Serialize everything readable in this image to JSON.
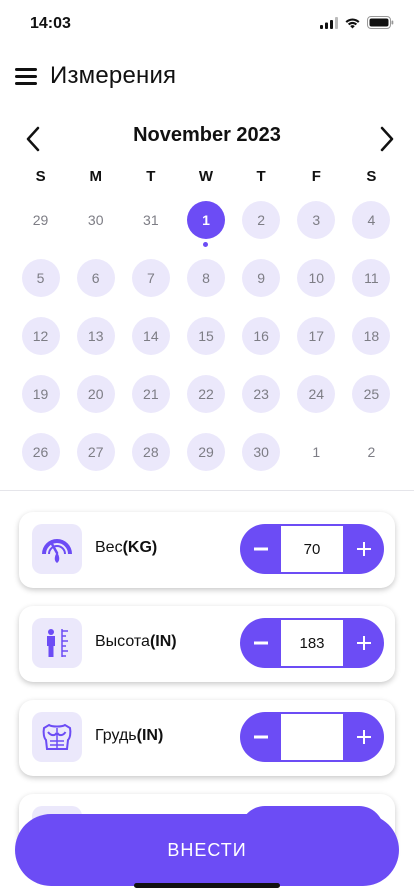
{
  "status_bar": {
    "time": "14:03"
  },
  "header": {
    "title": "Измерения"
  },
  "calendar": {
    "month_label": "November 2023",
    "weekdays": [
      "S",
      "M",
      "T",
      "W",
      "T",
      "F",
      "S"
    ],
    "days": [
      {
        "label": "29",
        "in_month": false
      },
      {
        "label": "30",
        "in_month": false
      },
      {
        "label": "31",
        "in_month": false
      },
      {
        "label": "1",
        "in_month": true,
        "selected": true,
        "has_entry": true
      },
      {
        "label": "2",
        "in_month": true
      },
      {
        "label": "3",
        "in_month": true
      },
      {
        "label": "4",
        "in_month": true
      },
      {
        "label": "5",
        "in_month": true
      },
      {
        "label": "6",
        "in_month": true
      },
      {
        "label": "7",
        "in_month": true
      },
      {
        "label": "8",
        "in_month": true
      },
      {
        "label": "9",
        "in_month": true
      },
      {
        "label": "10",
        "in_month": true
      },
      {
        "label": "11",
        "in_month": true
      },
      {
        "label": "12",
        "in_month": true
      },
      {
        "label": "13",
        "in_month": true
      },
      {
        "label": "14",
        "in_month": true
      },
      {
        "label": "15",
        "in_month": true
      },
      {
        "label": "16",
        "in_month": true
      },
      {
        "label": "17",
        "in_month": true
      },
      {
        "label": "18",
        "in_month": true
      },
      {
        "label": "19",
        "in_month": true
      },
      {
        "label": "20",
        "in_month": true
      },
      {
        "label": "21",
        "in_month": true
      },
      {
        "label": "22",
        "in_month": true
      },
      {
        "label": "23",
        "in_month": true
      },
      {
        "label": "24",
        "in_month": true
      },
      {
        "label": "25",
        "in_month": true
      },
      {
        "label": "26",
        "in_month": true
      },
      {
        "label": "27",
        "in_month": true
      },
      {
        "label": "28",
        "in_month": true
      },
      {
        "label": "29",
        "in_month": true
      },
      {
        "label": "30",
        "in_month": true
      },
      {
        "label": "1",
        "in_month": false
      },
      {
        "label": "2",
        "in_month": false
      }
    ]
  },
  "measurements": [
    {
      "label": "Вес",
      "unit": "(KG)",
      "icon": "weight-gauge-icon",
      "value": "70"
    },
    {
      "label": "Высота",
      "unit": "(IN)",
      "icon": "height-icon",
      "value": "183"
    },
    {
      "label": "Грудь",
      "unit": "(IN)",
      "icon": "chest-icon",
      "value": ""
    }
  ],
  "submit": {
    "label": "ВНЕСТИ"
  },
  "colors": {
    "accent": "#6c4cf5",
    "accent_light": "#ebe8fb"
  }
}
